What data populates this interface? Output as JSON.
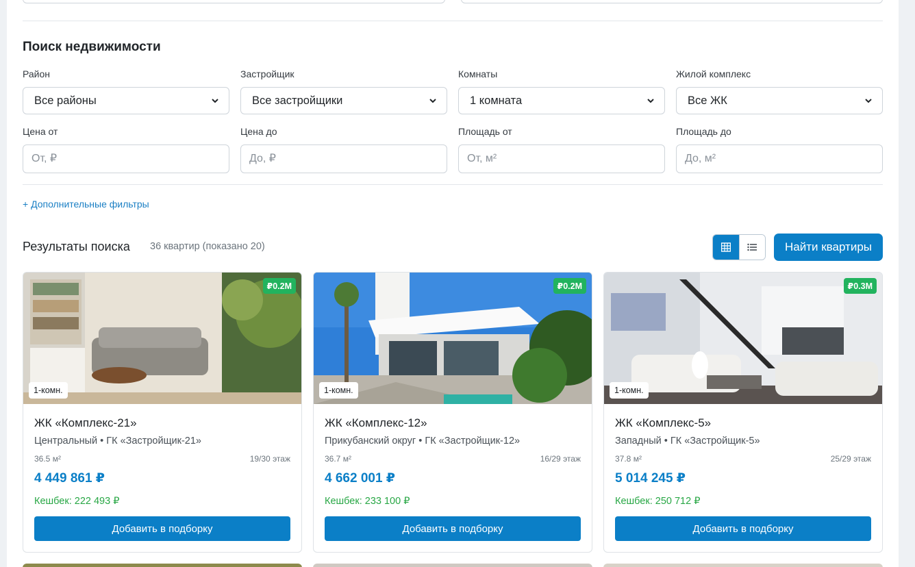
{
  "search": {
    "title": "Поиск недвижимости",
    "district": {
      "label": "Район",
      "value": "Все районы"
    },
    "developer": {
      "label": "Застройщик",
      "value": "Все застройщики"
    },
    "rooms": {
      "label": "Комнаты",
      "value": "1 комната"
    },
    "complex": {
      "label": "Жилой комплекс",
      "value": "Все ЖК"
    },
    "price_from": {
      "label": "Цена от",
      "placeholder": "От, ₽"
    },
    "price_to": {
      "label": "Цена до",
      "placeholder": "До, ₽"
    },
    "area_from": {
      "label": "Площадь от",
      "placeholder": "От, м²"
    },
    "area_to": {
      "label": "Площадь до",
      "placeholder": "До, м²"
    },
    "more_filters": "+ Дополнительные фильтры"
  },
  "results": {
    "title": "Результаты поиска",
    "count": "36 квартир (показано 20)",
    "find_button": "Найти квартиры",
    "view_grid_icon": "grid-icon",
    "view_list_icon": "list-icon"
  },
  "cards": [
    {
      "badge_price": "₽0.2M",
      "badge_rooms": "1-комн.",
      "title": "ЖК «Комплекс-21»",
      "subtitle": "Центральный • ГК «Застройщик-21»",
      "area": "36.5 м²",
      "floor": "19/30 этаж",
      "price": "4 449 861 ₽",
      "cashback": "Кешбек: 222 493 ₽",
      "button": "Добавить в подборку"
    },
    {
      "badge_price": "₽0.2M",
      "badge_rooms": "1-комн.",
      "title": "ЖК «Комплекс-12»",
      "subtitle": "Прикубанский округ • ГК «Застройщик-12»",
      "area": "36.7 м²",
      "floor": "16/29 этаж",
      "price": "4 662 001 ₽",
      "cashback": "Кешбек: 233 100 ₽",
      "button": "Добавить в подборку"
    },
    {
      "badge_price": "₽0.3M",
      "badge_rooms": "1-комн.",
      "title": "ЖК «Комплекс-5»",
      "subtitle": "Западный • ГК «Застройщик-5»",
      "area": "37.8 м²",
      "floor": "25/29 этаж",
      "price": "5 014 245 ₽",
      "cashback": "Кешбек: 250 712 ₽",
      "button": "Добавить в подборку"
    }
  ],
  "colors": {
    "accent": "#0b7fc7",
    "badge_green": "#22b35e",
    "cashback_green": "#28a745"
  }
}
